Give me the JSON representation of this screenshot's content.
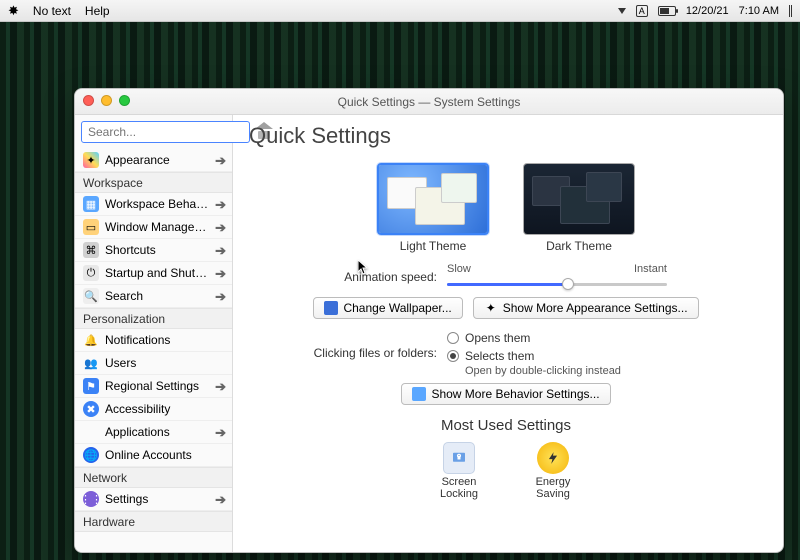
{
  "menubar": {
    "notext": "No text",
    "help": "Help",
    "date": "12/20/21",
    "time": "7:10 AM"
  },
  "window": {
    "title": "Quick Settings — System Settings",
    "search_placeholder": "Search..."
  },
  "heading": "Quick Settings",
  "sidebar": {
    "appearance": "Appearance",
    "cat_workspace": "Workspace",
    "workspace_behavior": "Workspace Behavior",
    "window_management": "Window Management",
    "shortcuts": "Shortcuts",
    "startup_shutdown": "Startup and Shutdown",
    "search": "Search",
    "cat_personalization": "Personalization",
    "notifications": "Notifications",
    "users": "Users",
    "regional": "Regional Settings",
    "accessibility": "Accessibility",
    "applications": "Applications",
    "online_accounts": "Online Accounts",
    "cat_network": "Network",
    "settings": "Settings",
    "cat_hardware": "Hardware"
  },
  "themes": {
    "light": "Light Theme",
    "dark": "Dark Theme"
  },
  "anim": {
    "label": "Animation speed:",
    "slow": "Slow",
    "instant": "Instant"
  },
  "buttons": {
    "change_wallpaper": "Change Wallpaper...",
    "more_appearance": "Show More Appearance Settings...",
    "more_behavior": "Show More Behavior Settings..."
  },
  "click": {
    "label": "Clicking files or folders:",
    "opens": "Opens them",
    "selects": "Selects them",
    "hint": "Open by double-clicking instead"
  },
  "most_used": {
    "title": "Most Used Settings",
    "screen_locking_l1": "Screen",
    "screen_locking_l2": "Locking",
    "energy_l1": "Energy",
    "energy_l2": "Saving"
  }
}
